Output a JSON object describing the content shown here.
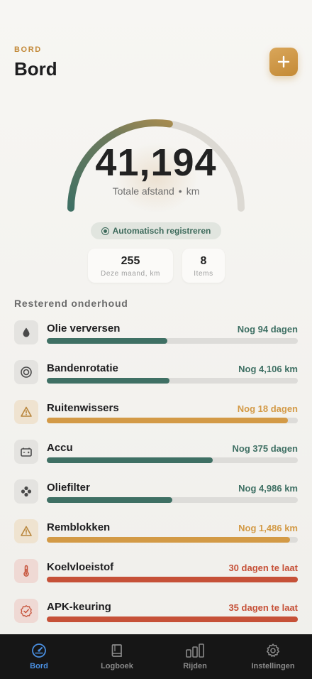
{
  "header": {
    "eyebrow": "BORD",
    "title": "Bord"
  },
  "add_button": {
    "label": "+"
  },
  "odometer": {
    "value": "41,194",
    "caption": "Totale afstand",
    "separator": "•",
    "unit": "km",
    "progress_fraction": 0.55
  },
  "auto_register": {
    "label": "Automatisch registreren"
  },
  "stats": [
    {
      "value": "255",
      "label": "Deze maand, km"
    },
    {
      "value": "8",
      "label": "Items"
    }
  ],
  "section_title": "Resterend onderhoud",
  "maintenance": [
    {
      "name": "Olie verversen",
      "status": "Nog 94 dagen",
      "state": "ok",
      "icon": "oil-drop-icon",
      "progress": 0.48
    },
    {
      "name": "Bandenrotatie",
      "status": "Nog 4,106 km",
      "state": "ok",
      "icon": "tire-icon",
      "progress": 0.49
    },
    {
      "name": "Ruitenwissers",
      "status": "Nog 18 dagen",
      "state": "warn",
      "icon": "warning-icon",
      "progress": 0.96
    },
    {
      "name": "Accu",
      "status": "Nog 375 dagen",
      "state": "ok",
      "icon": "battery-icon",
      "progress": 0.66
    },
    {
      "name": "Oliefilter",
      "status": "Nog 4,986 km",
      "state": "ok",
      "icon": "filter-icon",
      "progress": 0.5
    },
    {
      "name": "Remblokken",
      "status": "Nog 1,486 km",
      "state": "warn",
      "icon": "warning-icon",
      "progress": 0.97
    },
    {
      "name": "Koelvloeistof",
      "status": "30 dagen te laat",
      "state": "late",
      "icon": "thermometer-icon",
      "progress": 1.0
    },
    {
      "name": "APK-keuring",
      "status": "35 dagen te laat",
      "state": "late",
      "icon": "badge-check-icon",
      "progress": 1.0
    }
  ],
  "colors": {
    "ok": "#3f7064",
    "warn": "#d39a46",
    "late": "#c65138",
    "accent": "#c38a3a",
    "tab_active": "#4a8fe0"
  },
  "tabs": [
    {
      "label": "Bord",
      "icon": "speedometer-icon",
      "active": true
    },
    {
      "label": "Logboek",
      "icon": "book-icon",
      "active": false
    },
    {
      "label": "Rijden",
      "icon": "bar-chart-icon",
      "active": false
    },
    {
      "label": "Instellingen",
      "icon": "gear-icon",
      "active": false
    }
  ]
}
